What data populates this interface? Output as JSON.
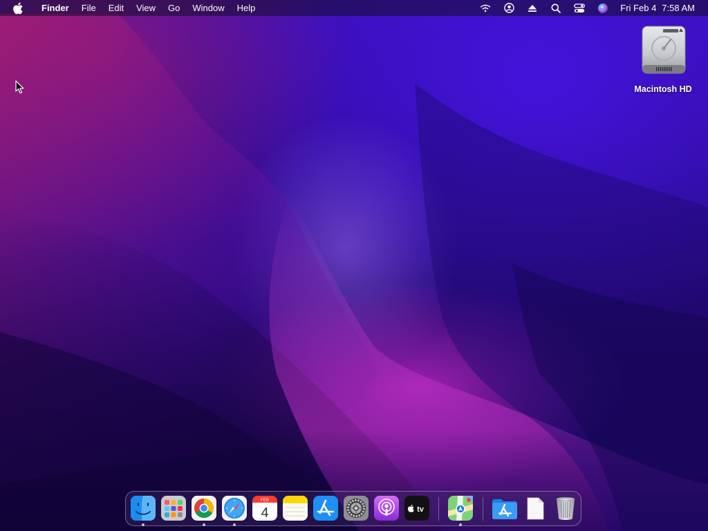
{
  "menubar": {
    "apple_icon": "apple-logo-icon",
    "app_name": "Finder",
    "menus": [
      "File",
      "Edit",
      "View",
      "Go",
      "Window",
      "Help"
    ],
    "status_icons": [
      "wifi-icon",
      "user-account-icon",
      "eject-icon",
      "search-icon",
      "control-center-icon",
      "siri-icon"
    ],
    "clock": {
      "day": "Fri Feb 4",
      "time": "7:58 AM"
    }
  },
  "desktop": {
    "icons": [
      {
        "label": "Macintosh HD",
        "icon": "hard-drive-icon"
      }
    ]
  },
  "dock": {
    "apps": [
      {
        "name": "finder",
        "icon": "finder-icon",
        "running": true
      },
      {
        "name": "launchpad",
        "icon": "launchpad-icon",
        "running": false
      },
      {
        "name": "chrome",
        "icon": "chrome-icon",
        "running": true
      },
      {
        "name": "safari",
        "icon": "safari-icon",
        "running": true
      },
      {
        "name": "calendar",
        "icon": "calendar-icon",
        "running": false
      },
      {
        "name": "notes",
        "icon": "notes-icon",
        "running": false
      },
      {
        "name": "app-store",
        "icon": "app-store-icon",
        "running": false
      },
      {
        "name": "system-preferences",
        "icon": "gear-icon",
        "running": false
      },
      {
        "name": "podcasts",
        "icon": "podcasts-icon",
        "running": false
      },
      {
        "name": "apple-tv",
        "icon": "apple-tv-icon",
        "running": false
      },
      {
        "name": "maps",
        "icon": "maps-icon",
        "running": true
      },
      {
        "name": "applications-folder",
        "icon": "app-store-folder-icon",
        "running": false
      },
      {
        "name": "document",
        "icon": "document-icon",
        "running": false
      },
      {
        "name": "trash",
        "icon": "trash-icon",
        "running": false
      }
    ],
    "calendar": {
      "month": "FEB",
      "day": "4"
    },
    "tv_label": "tv"
  },
  "colors": {
    "wallpaper_top": "#3a0fb3",
    "wallpaper_bottom": "#14054a",
    "wallpaper_glow": "#c428c8",
    "menubar_text": "#ffffff"
  }
}
